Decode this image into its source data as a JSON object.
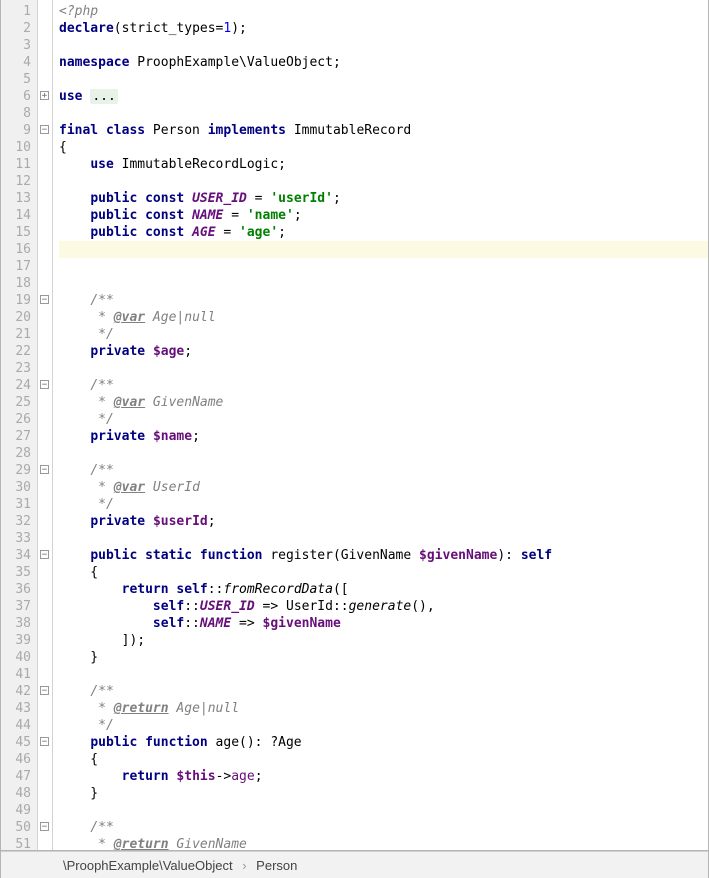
{
  "lines": [
    {
      "n": 1,
      "html": "<span class='cmt'>&lt;?php</span>"
    },
    {
      "n": 2,
      "html": "<span class='kw'>declare</span>(strict_types=<span class='num'>1</span>);"
    },
    {
      "n": 3,
      "html": ""
    },
    {
      "n": 4,
      "html": "<span class='kw'>namespace</span> ProophExample\\ValueObject;"
    },
    {
      "n": 5,
      "html": ""
    },
    {
      "n": 6,
      "html": "<span class='kw'>use</span> <span class='fold-box'>...</span>",
      "fold": "plus"
    },
    {
      "n": 8,
      "html": ""
    },
    {
      "n": 9,
      "html": "<span class='kw'>final class</span> Person <span class='kw'>implements</span> ImmutableRecord",
      "fold": "minus"
    },
    {
      "n": 10,
      "html": "{"
    },
    {
      "n": 11,
      "html": "    <span class='kw'>use</span> ImmutableRecordLogic;"
    },
    {
      "n": 12,
      "html": ""
    },
    {
      "n": 13,
      "html": "    <span class='kw'>public const</span> <span class='prop'>USER_ID</span> = <span class='str'>'userId'</span>;"
    },
    {
      "n": 14,
      "html": "    <span class='kw'>public const</span> <span class='prop'>NAME</span> = <span class='str'>'name'</span>;"
    },
    {
      "n": 15,
      "html": "    <span class='kw'>public const</span> <span class='prop'>AGE</span> = <span class='str'>'age'</span>;"
    },
    {
      "n": 16,
      "html": "",
      "current": true
    },
    {
      "n": 17,
      "html": ""
    },
    {
      "n": 18,
      "html": ""
    },
    {
      "n": 19,
      "html": "    <span class='cmt'>/**</span>",
      "fold": "minus"
    },
    {
      "n": 20,
      "html": "    <span class='cmt'> * <span class='doc-tag'>@var</span> Age|null</span>"
    },
    {
      "n": 21,
      "html": "    <span class='cmt'> */</span>"
    },
    {
      "n": 22,
      "html": "    <span class='kw'>private</span> <span class='var'>$age</span>;"
    },
    {
      "n": 23,
      "html": ""
    },
    {
      "n": 24,
      "html": "    <span class='cmt'>/**</span>",
      "fold": "minus"
    },
    {
      "n": 25,
      "html": "    <span class='cmt'> * <span class='doc-tag'>@var</span> GivenName</span>"
    },
    {
      "n": 26,
      "html": "    <span class='cmt'> */</span>"
    },
    {
      "n": 27,
      "html": "    <span class='kw'>private</span> <span class='var'>$name</span>;"
    },
    {
      "n": 28,
      "html": ""
    },
    {
      "n": 29,
      "html": "    <span class='cmt'>/**</span>",
      "fold": "minus"
    },
    {
      "n": 30,
      "html": "    <span class='cmt'> * <span class='doc-tag'>@var</span> UserId</span>"
    },
    {
      "n": 31,
      "html": "    <span class='cmt'> */</span>"
    },
    {
      "n": 32,
      "html": "    <span class='kw'>private</span> <span class='var'>$userId</span>;"
    },
    {
      "n": 33,
      "html": ""
    },
    {
      "n": 34,
      "html": "    <span class='kw'>public static function</span> register(GivenName <span class='var'>$givenName</span>): <span class='kw'>self</span>",
      "fold": "minus"
    },
    {
      "n": 35,
      "html": "    {"
    },
    {
      "n": 36,
      "html": "        <span class='kw'>return self</span>::<span class='ital'>fromRecordData</span>(["
    },
    {
      "n": 37,
      "html": "            <span class='kw'>self</span>::<span class='prop'>USER_ID</span> =&gt; UserId::<span class='ital'>generate</span>(),"
    },
    {
      "n": 38,
      "html": "            <span class='kw'>self</span>::<span class='prop'>NAME</span> =&gt; <span class='var'>$givenName</span>"
    },
    {
      "n": 39,
      "html": "        ]);"
    },
    {
      "n": 40,
      "html": "    }"
    },
    {
      "n": 41,
      "html": ""
    },
    {
      "n": 42,
      "html": "    <span class='cmt'>/**</span>",
      "fold": "minus"
    },
    {
      "n": 43,
      "html": "    <span class='cmt'> * <span class='doc-tag'>@return</span> Age|null</span>"
    },
    {
      "n": 44,
      "html": "    <span class='cmt'> */</span>"
    },
    {
      "n": 45,
      "html": "    <span class='kw'>public function</span> age(): ?Age",
      "fold": "minus"
    },
    {
      "n": 46,
      "html": "    {"
    },
    {
      "n": 47,
      "html": "        <span class='kw'>return</span> <span class='var'>$this</span>-&gt;<span class='var' style='font-weight:normal'>age</span>;"
    },
    {
      "n": 48,
      "html": "    }"
    },
    {
      "n": 49,
      "html": ""
    },
    {
      "n": 50,
      "html": "    <span class='cmt'>/**</span>",
      "fold": "minus"
    },
    {
      "n": 51,
      "html": "    <span class='cmt'> * <span class='doc-tag'>@return</span> GivenName</span>"
    }
  ],
  "breadcrumb": {
    "root": "\\ProophExample\\ValueObject",
    "leaf": "Person",
    "sep": "›"
  }
}
